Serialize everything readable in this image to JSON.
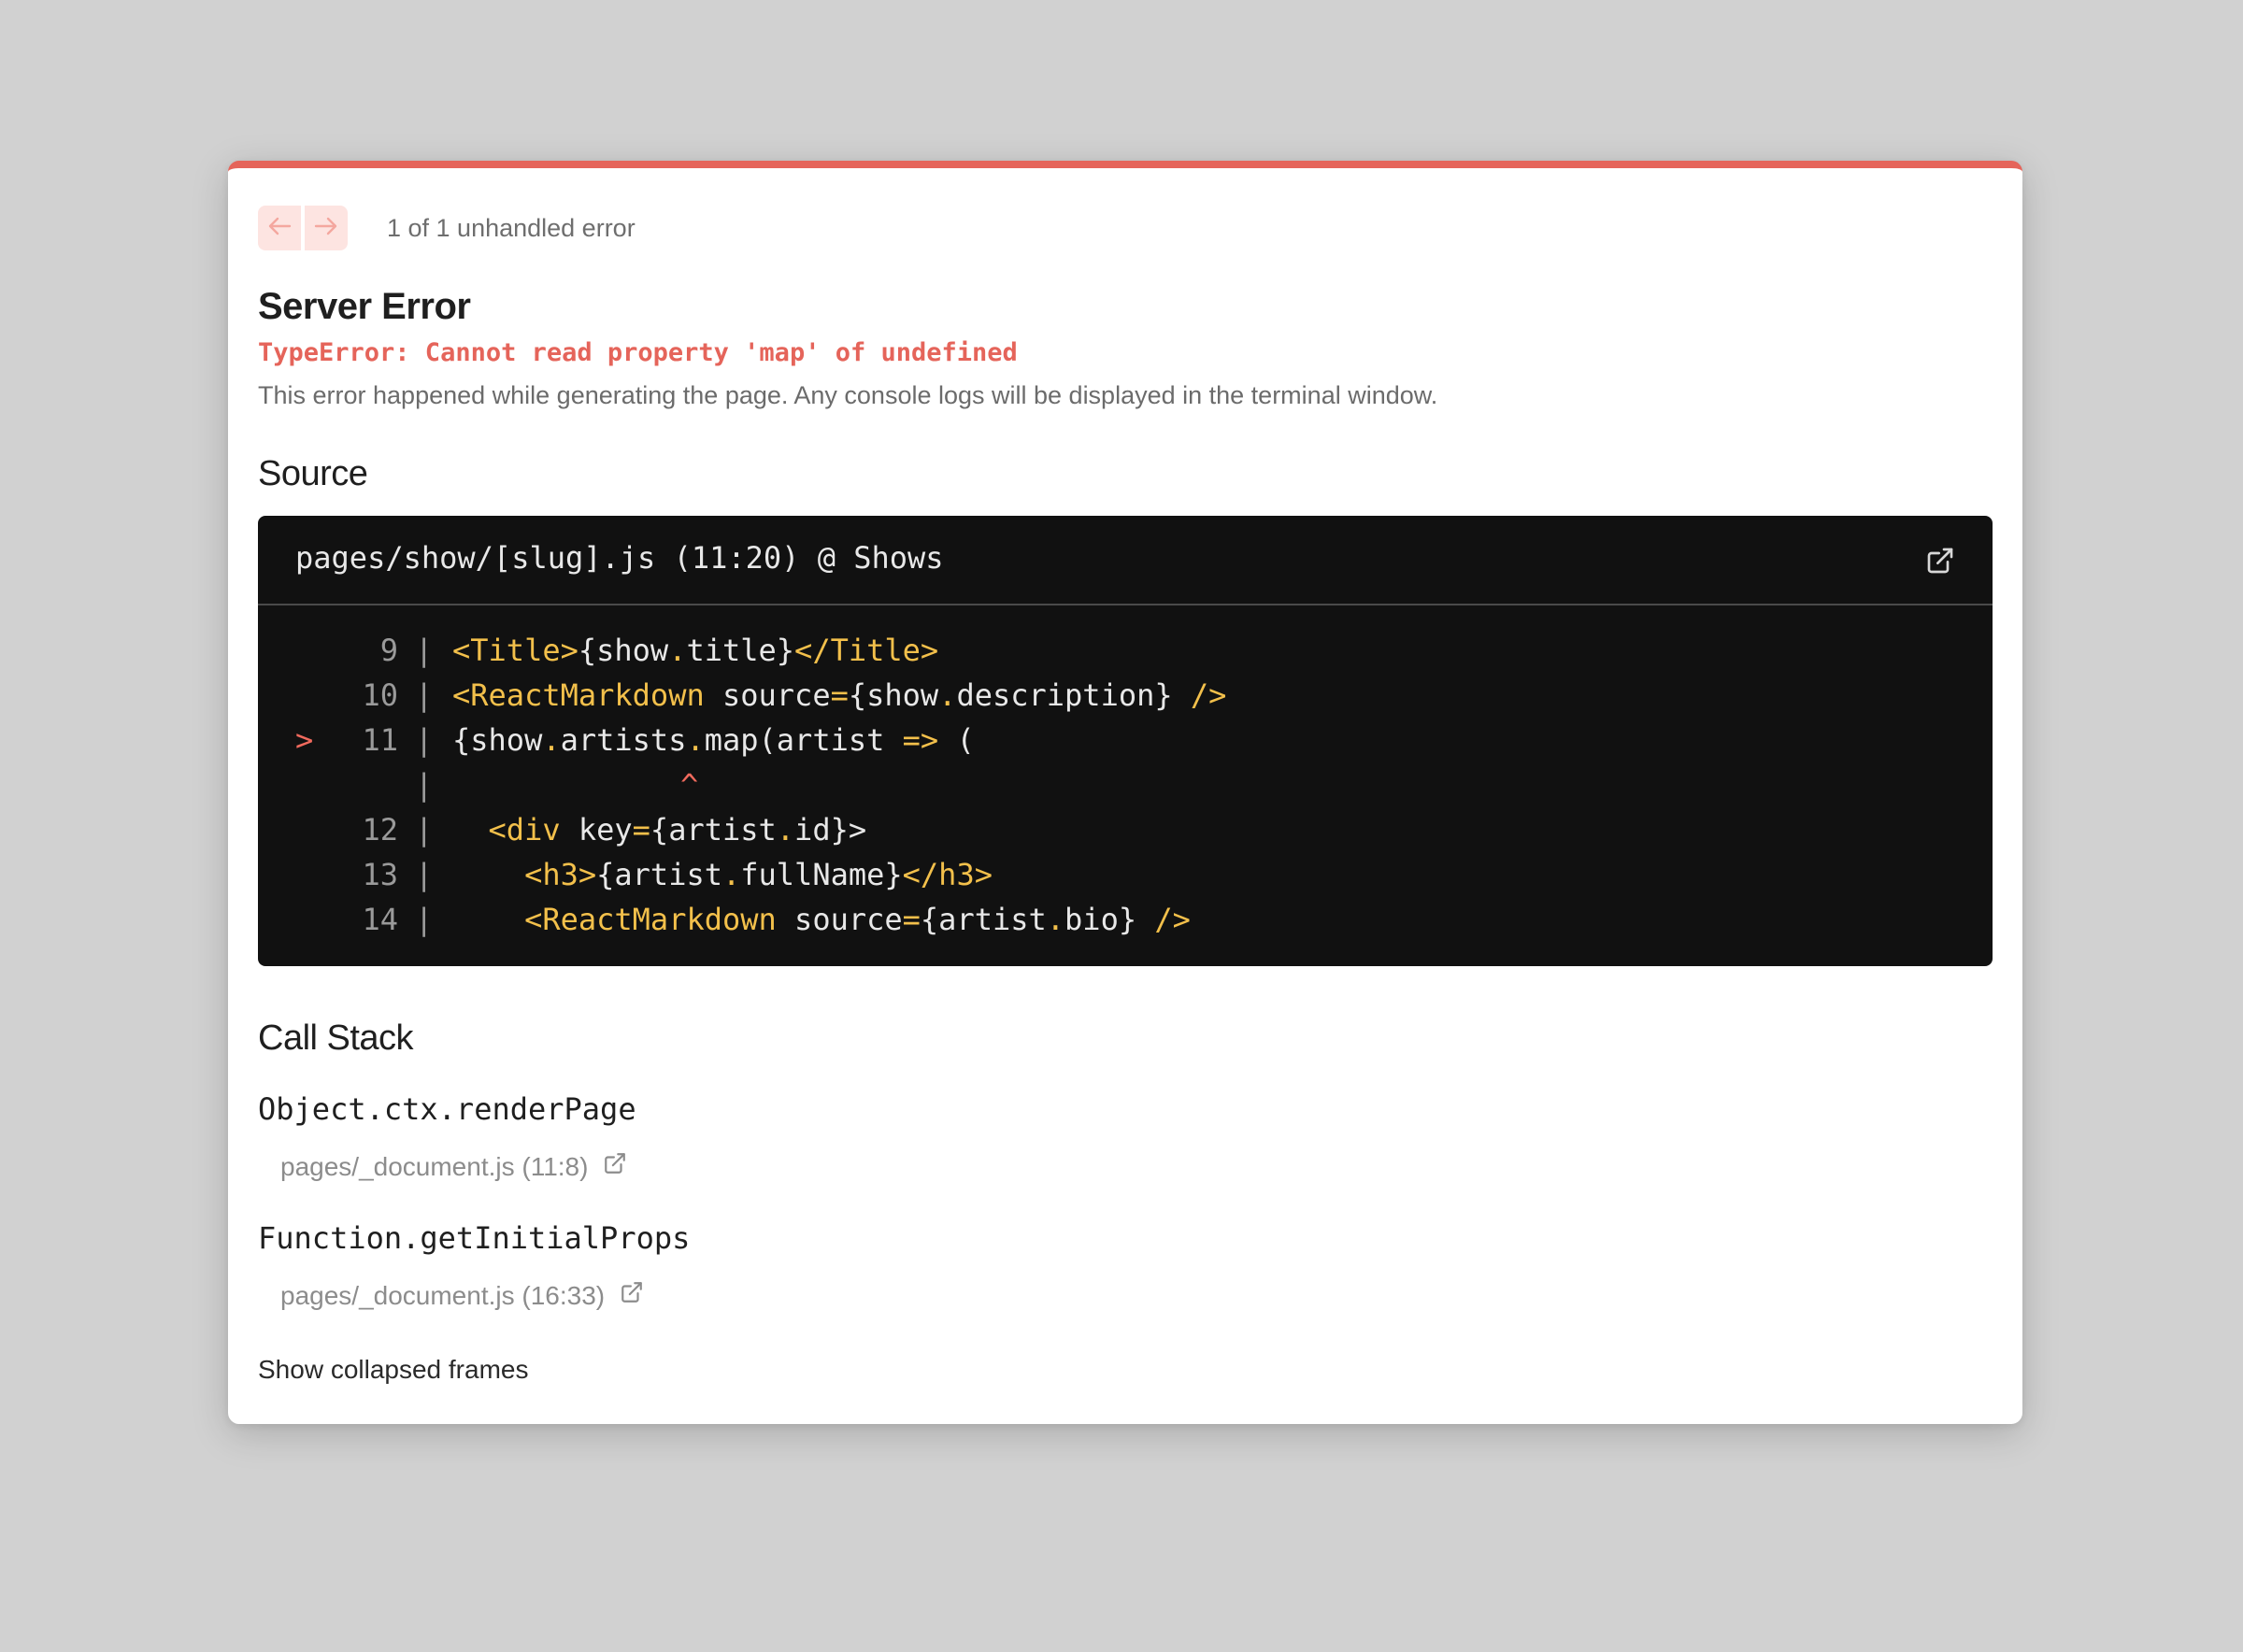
{
  "nav": {
    "prev_icon": "arrow-left-icon",
    "next_icon": "arrow-right-icon",
    "count_text": "1 of 1 unhandled error"
  },
  "error": {
    "title": "Server Error",
    "message": "TypeError: Cannot read property 'map' of undefined",
    "description": "This error happened while generating the page. Any console logs will be displayed in the terminal window."
  },
  "source": {
    "heading": "Source",
    "file": "pages/show/[slug].js (11:20) @ Shows",
    "open_icon": "external-link-icon",
    "lines": [
      {
        "marker": "",
        "num": "9",
        "pipe": "|",
        "code": "<Title>{show.title}</Title>"
      },
      {
        "marker": "",
        "num": "10",
        "pipe": "|",
        "code": "<ReactMarkdown source={show.description} />"
      },
      {
        "marker": ">",
        "num": "11",
        "pipe": "|",
        "code": "{show.artists.map(artist => ("
      },
      {
        "marker": "",
        "num": "",
        "pipe": "|",
        "code": "",
        "caret": "^"
      },
      {
        "marker": "",
        "num": "12",
        "pipe": "|",
        "code": "  <div key={artist.id}>"
      },
      {
        "marker": "",
        "num": "13",
        "pipe": "|",
        "code": "    <h3>{artist.fullName}</h3>"
      },
      {
        "marker": "",
        "num": "14",
        "pipe": "|",
        "code": "    <ReactMarkdown source={artist.bio} />"
      }
    ]
  },
  "call_stack": {
    "heading": "Call Stack",
    "frames": [
      {
        "function": "Object.ctx.renderPage",
        "location": "pages/_document.js (11:8)",
        "icon": "external-link-icon"
      },
      {
        "function": "Function.getInitialProps",
        "location": "pages/_document.js (16:33)",
        "icon": "external-link-icon"
      }
    ],
    "collapsed_label": "Show collapsed frames"
  },
  "colors": {
    "accent": "#e5645a",
    "code_bg": "#111111",
    "code_tag": "#f3c04b"
  }
}
